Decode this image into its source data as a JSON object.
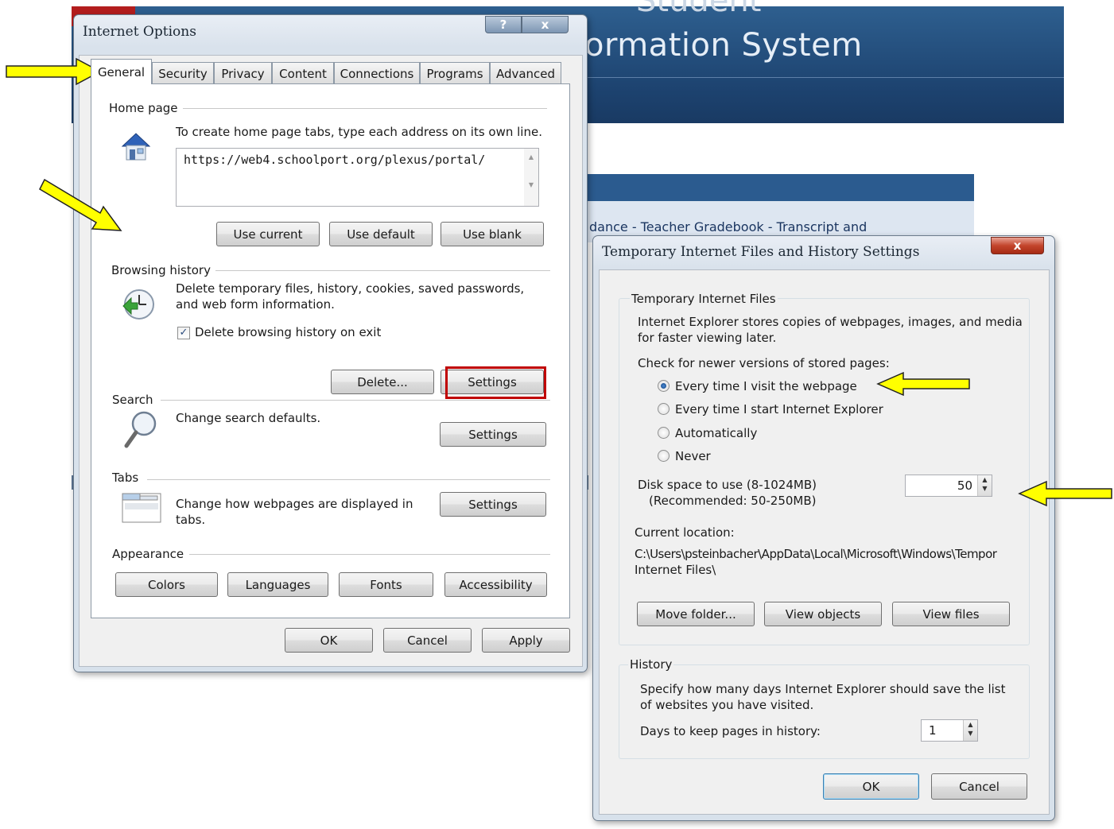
{
  "background": {
    "title_partial_top": "Student",
    "title_partial": "ormation System",
    "nav_links": "dance - Teacher Gradebook - Transcript and"
  },
  "internet_options": {
    "title": "Internet Options",
    "help_button": "?",
    "close_button": "x",
    "tabs": [
      "General",
      "Security",
      "Privacy",
      "Content",
      "Connections",
      "Programs",
      "Advanced"
    ],
    "active_tab": "General",
    "home_page": {
      "group_label": "Home page",
      "instruction": "To create home page tabs, type each address on its own line.",
      "url": "https://web4.schoolport.org/plexus/portal/",
      "use_current": "Use current",
      "use_default": "Use default",
      "use_blank": "Use blank"
    },
    "browsing_history": {
      "group_label": "Browsing history",
      "description_line1": "Delete temporary files, history, cookies, saved passwords,",
      "description_line2": "and web form information.",
      "checkbox_label": "Delete browsing history on exit",
      "checkbox_checked": true,
      "delete_button": "Delete...",
      "settings_button": "Settings"
    },
    "search": {
      "group_label": "Search",
      "description": "Change search defaults.",
      "settings_button": "Settings"
    },
    "tabs_group": {
      "group_label": "Tabs",
      "description_line1": "Change how webpages are displayed in",
      "description_line2": "tabs.",
      "settings_button": "Settings"
    },
    "appearance": {
      "group_label": "Appearance",
      "colors": "Colors",
      "languages": "Languages",
      "fonts": "Fonts",
      "accessibility": "Accessibility"
    },
    "footer": {
      "ok": "OK",
      "cancel": "Cancel",
      "apply": "Apply"
    }
  },
  "temp_files_dialog": {
    "title": "Temporary Internet Files and History Settings",
    "close_button": "x",
    "temporary_files": {
      "group_label": "Temporary Internet Files",
      "description_line1": "Internet Explorer stores copies of webpages, images, and media",
      "description_line2": "for faster viewing later.",
      "check_label": "Check for newer versions of stored pages:",
      "options": [
        "Every time I visit the webpage",
        "Every time I start Internet Explorer",
        "Automatically",
        "Never"
      ],
      "selected_option": "Every time I visit the webpage",
      "disk_space_label": "Disk space to use (8-1024MB)",
      "disk_space_recommended": "(Recommended: 50-250MB)",
      "disk_space_value": "50",
      "current_location_label": "Current location:",
      "location_line1": "C:\\Users\\psteinbacher\\AppData\\Local\\Microsoft\\Windows\\Tempor",
      "location_line2": "Internet Files\\",
      "move_folder": "Move folder...",
      "view_objects": "View objects",
      "view_files": "View files"
    },
    "history": {
      "group_label": "History",
      "description_line1": "Specify how many days Internet Explorer should save the list",
      "description_line2": "of websites you have visited.",
      "days_label": "Days to keep pages in history:",
      "days_value": "1"
    },
    "footer": {
      "ok": "OK",
      "cancel": "Cancel"
    }
  },
  "annotations": {
    "arrow_color": "#ffff00",
    "highlight_color": "#c00000"
  }
}
